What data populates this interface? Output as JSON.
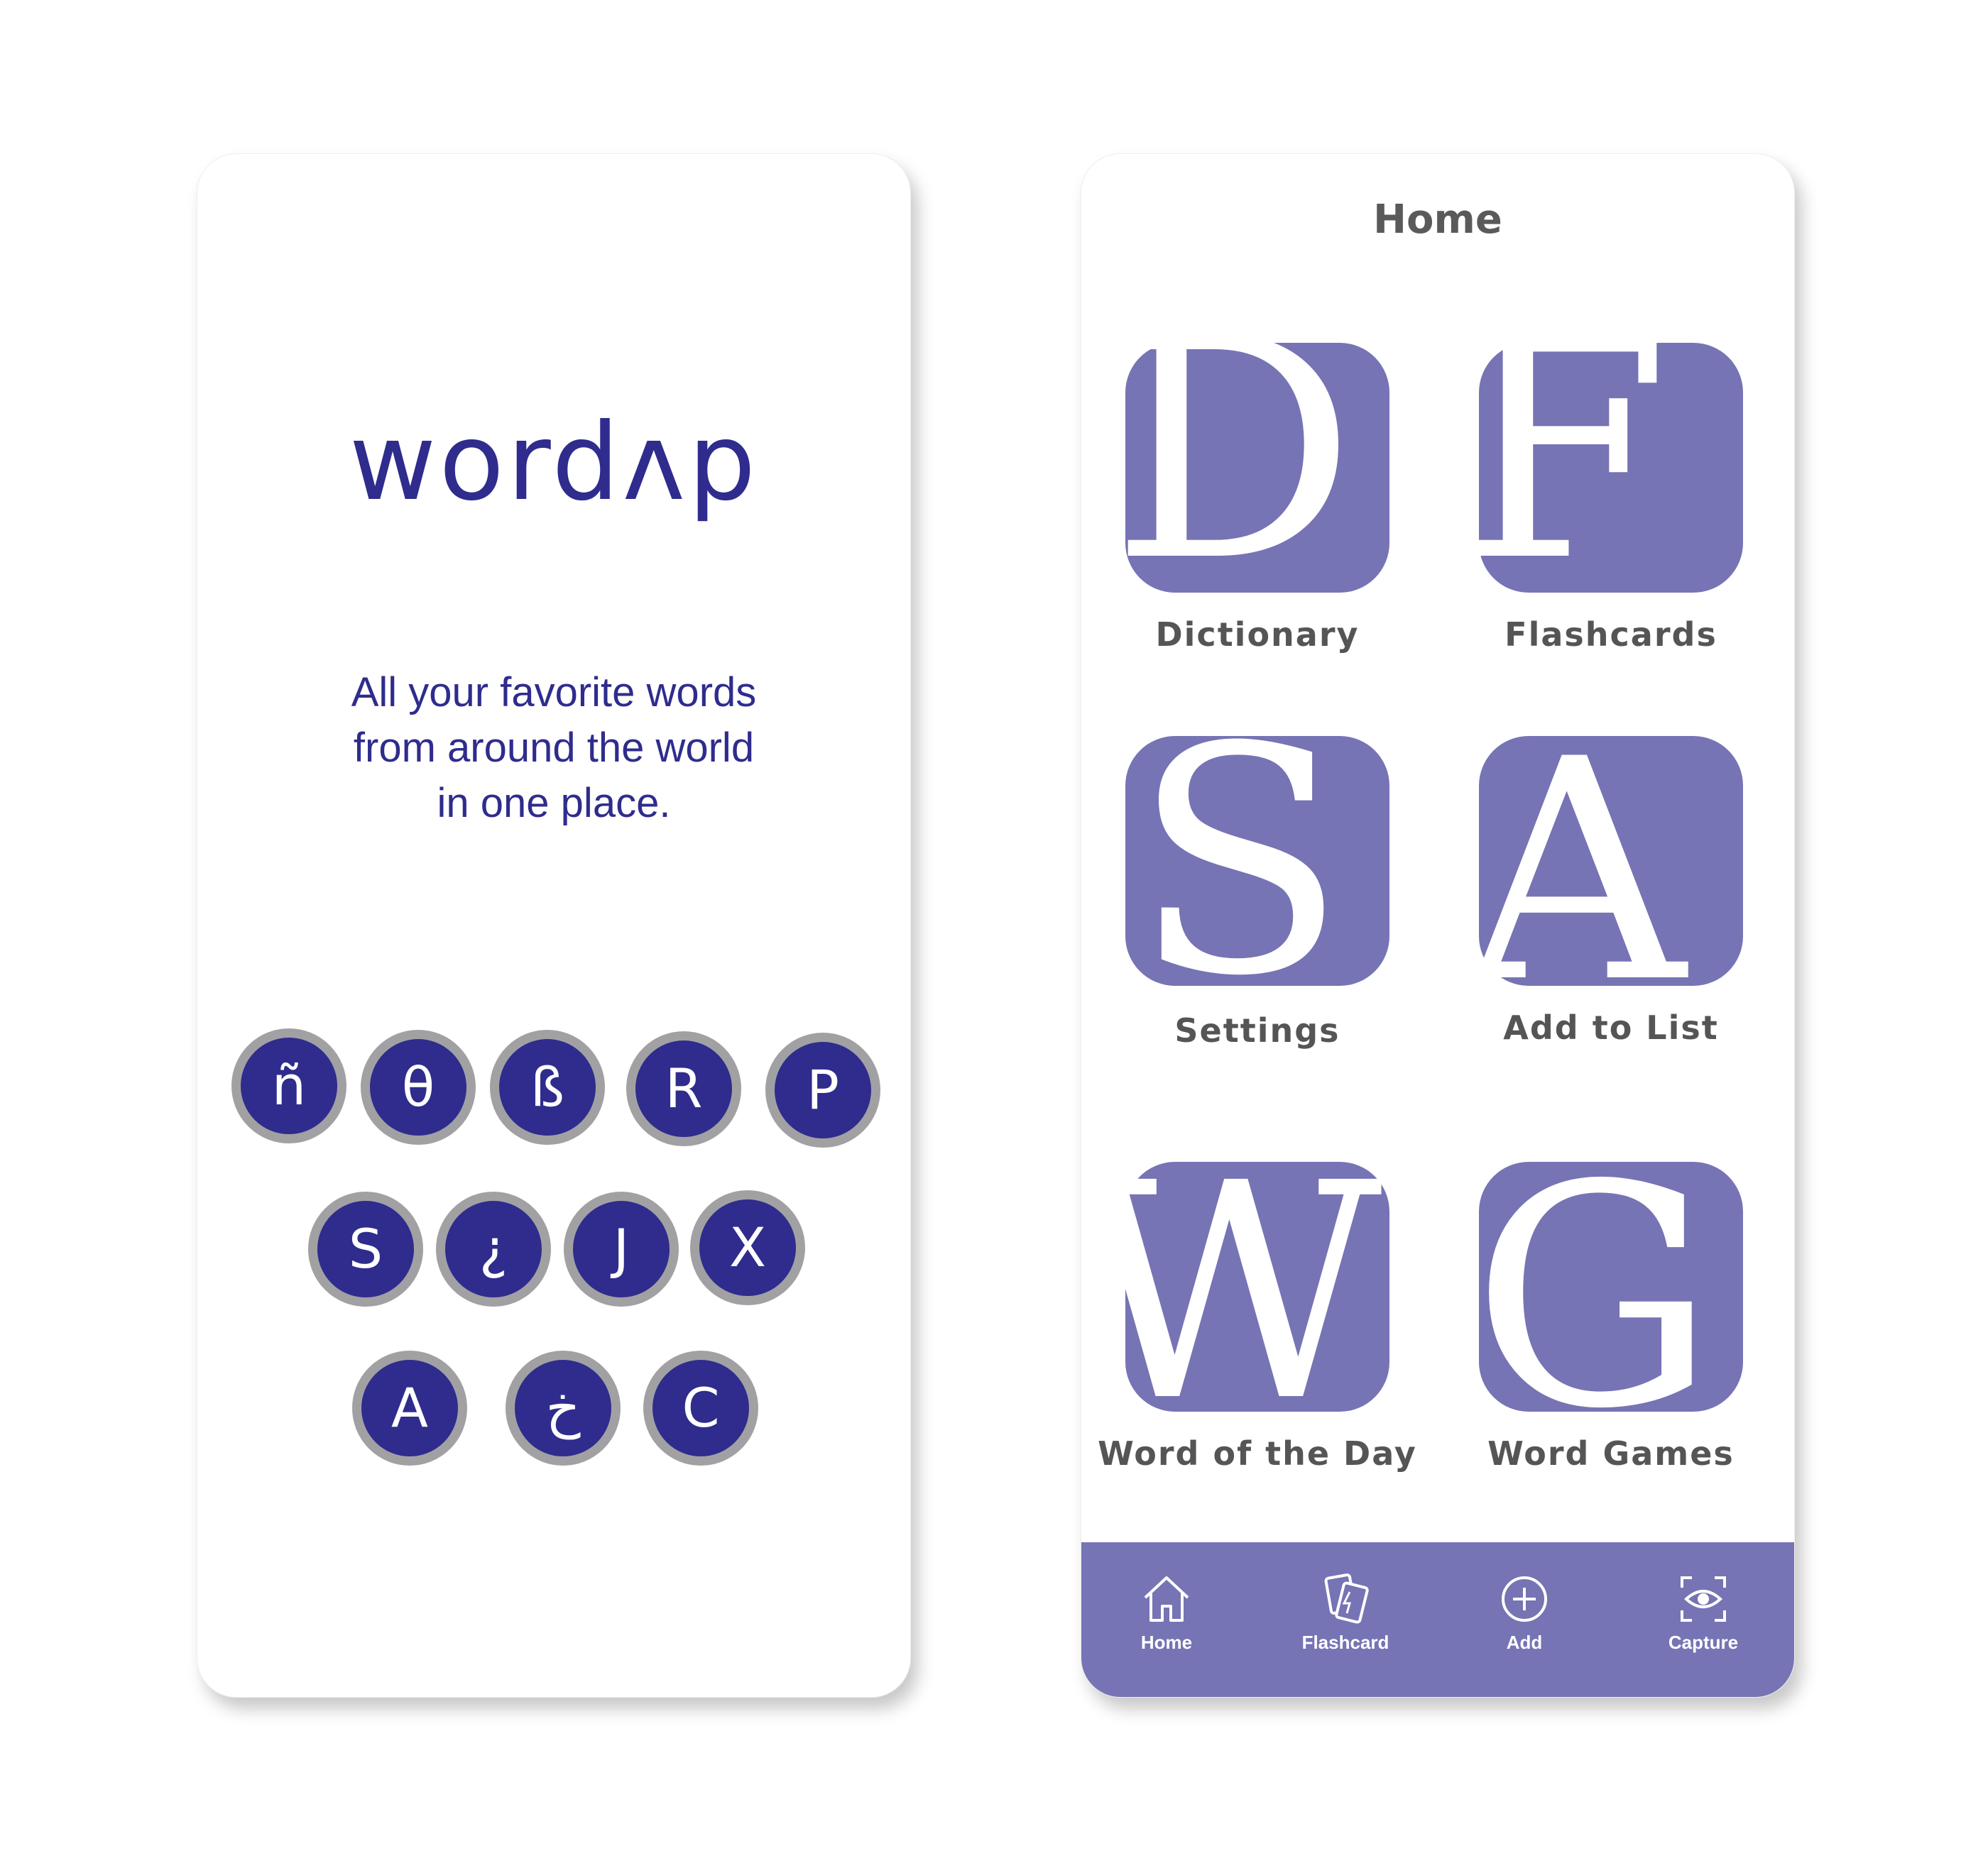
{
  "splash": {
    "logo": "wordʌp",
    "tagline": [
      "All your favorite words",
      "from around the world",
      "in one place."
    ],
    "letters": [
      "ñ",
      "θ",
      "ß",
      "R",
      "P",
      "S",
      "¿",
      "J",
      "X",
      "A",
      "خ",
      "C"
    ],
    "colors": {
      "brand": "#2f2c8d",
      "coin_ring": "#a1a1a4"
    }
  },
  "home": {
    "title": "Home",
    "tiles": [
      {
        "letter": "D",
        "label": "Dictionary"
      },
      {
        "letter": "F",
        "label": "Flashcards"
      },
      {
        "letter": "S",
        "label": "Settings"
      },
      {
        "letter": "A",
        "label": "Add to List"
      },
      {
        "letter": "W",
        "label": "Word of the Day"
      },
      {
        "letter": "G",
        "label": "Word Games"
      }
    ],
    "tabs": [
      {
        "label": "Home",
        "icon": "house-icon"
      },
      {
        "label": "Flashcard",
        "icon": "flashcard-icon"
      },
      {
        "label": "Add",
        "icon": "plus-circle-icon"
      },
      {
        "label": "Capture",
        "icon": "eye-scan-icon"
      }
    ],
    "colors": {
      "accent": "#7674b4",
      "text": "#555555"
    }
  }
}
